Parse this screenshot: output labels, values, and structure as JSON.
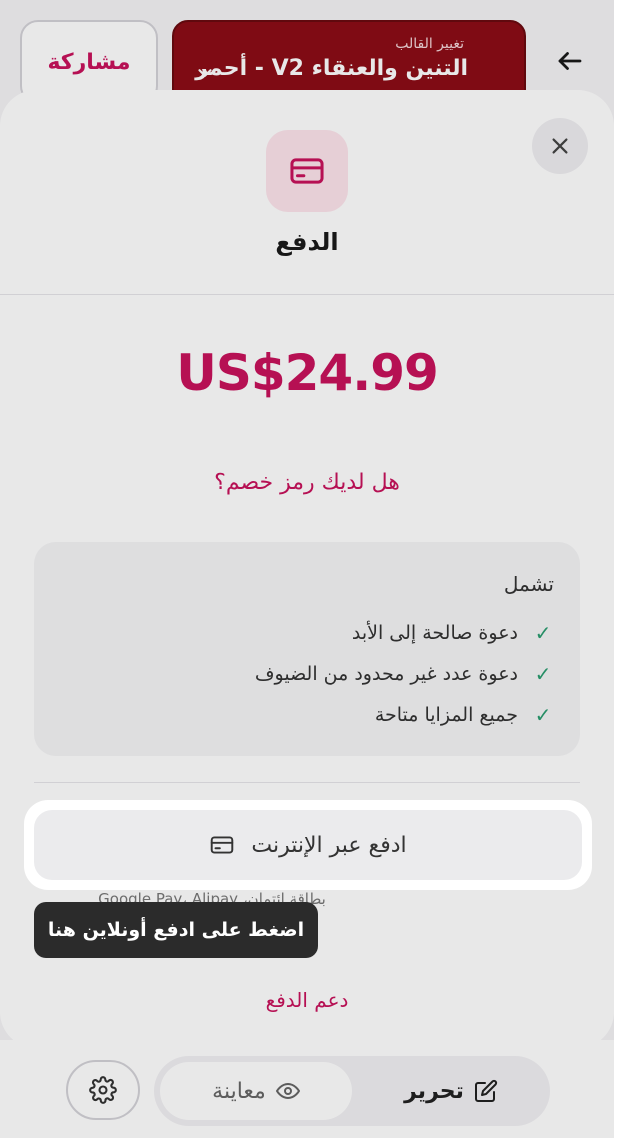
{
  "topbar": {
    "template_caption": "تغيير القالب",
    "template_name": "التنين والعنقاء V2 - أحمر",
    "share_label": "مشاركة"
  },
  "modal": {
    "title": "الدفع",
    "price": "US$24.99",
    "coupon_link": "هل لديك رمز خصم؟",
    "includes": {
      "title": "تشمل",
      "features": [
        "دعوة صالحة إلى الأبد",
        "دعوة عدد غير محدود من الضيوف",
        "جميع المزايا متاحة"
      ]
    },
    "pay_online_label": "ادفع عبر الإنترنت",
    "methods_text": "بطاقة ائتمان، Google Pay، Alipay",
    "support_link": "دعم الدفع"
  },
  "tooltip": {
    "text": "اضغط على ادفع أونلاين هنا"
  },
  "bottom_nav": {
    "preview_label": "معاينة",
    "edit_label": "تحرير"
  },
  "colors": {
    "accent": "#c8125c",
    "template_bg": "#8c0d16",
    "check": "#2a9d70"
  },
  "icons": {
    "back": "arrow-left-icon",
    "close": "close-icon",
    "card": "credit-card-icon",
    "check": "check-icon",
    "settings": "gear-icon",
    "preview": "eye-icon",
    "edit": "edit-icon",
    "chevron": "chevron-down-icon"
  }
}
